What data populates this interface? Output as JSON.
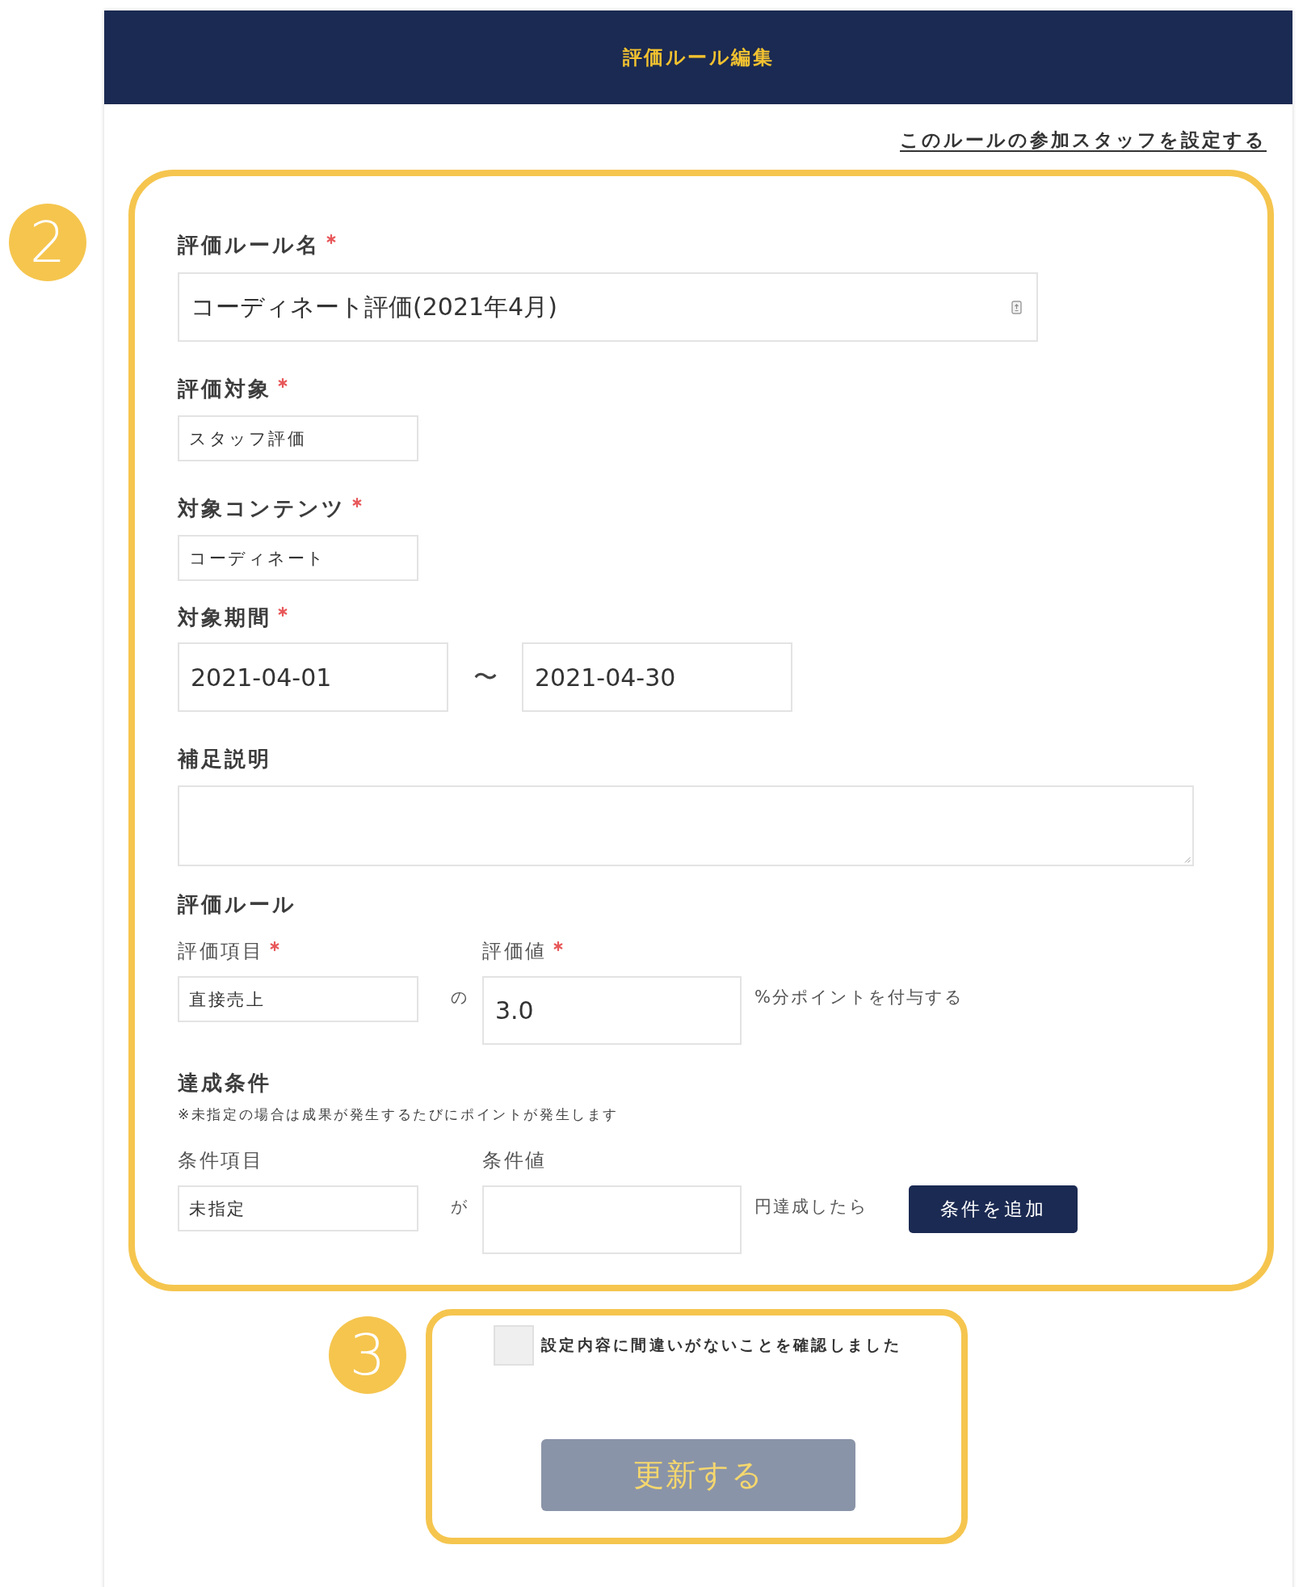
{
  "header": {
    "title": "評価ルール編集"
  },
  "staff_link": {
    "label": "このルールの参加スタッフを設定する"
  },
  "form": {
    "callout": "2",
    "fields": [
      {
        "kind": "rule_name",
        "label": "評価ルール名",
        "required": true,
        "value": "コーディネート評価(2021年4月)"
      },
      {
        "kind": "choice",
        "label": "評価対象",
        "required": true,
        "value": "スタッフ評価"
      },
      {
        "kind": "choice",
        "label": "対象コンテンツ",
        "required": true,
        "value": "コーディネート"
      },
      {
        "kind": "date_range",
        "label": "対象期間",
        "required": true,
        "start": "2021-04-01",
        "separator": "〜",
        "end": "2021-04-30"
      },
      {
        "kind": "textarea",
        "label": "補足説明",
        "required": false
      }
    ],
    "rules": [
      {
        "heading": "評価ルール",
        "item": {
          "label": "評価項目",
          "required": true,
          "value": "直接売上"
        },
        "connector": "の",
        "amount": {
          "label": "評価値",
          "required": true,
          "value": "3.0"
        },
        "suffix": "%分ポイントを付与する"
      },
      {
        "heading": "達成条件",
        "note": "※未指定の場合は成果が発生するたびにポイントが発生します",
        "item": {
          "label": "条件項目",
          "required": false,
          "value": "未指定"
        },
        "connector": "が",
        "amount": {
          "label": "条件値",
          "required": false
        },
        "suffix": "円達成したら",
        "add_button": "条件を追加"
      }
    ]
  },
  "confirm": {
    "callout": "3",
    "checkbox": {
      "label": "設定内容に間違いがないことを確認しました",
      "checked": false
    },
    "submit": {
      "label": "更新する",
      "disabled": true
    }
  }
}
